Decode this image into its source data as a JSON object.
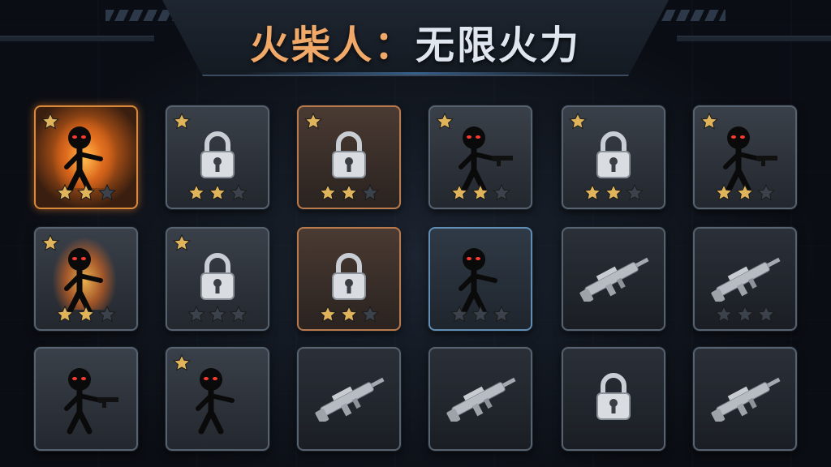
{
  "title": {
    "part1": "火柴人：",
    "part2": "无限火力"
  },
  "colors": {
    "star_gold": "#e0b45a",
    "star_empty": "#3c424b",
    "accent_orange": "#d9893a",
    "accent_blue": "#5f8db5"
  },
  "cards": [
    {
      "name": "card-1",
      "style": "active",
      "content": "stickman",
      "corner_star": true,
      "stars_filled": 2,
      "stars_total": 3,
      "fire": true
    },
    {
      "name": "card-2",
      "style": "normal",
      "content": "lock",
      "corner_star": true,
      "stars_filled": 2,
      "stars_total": 3
    },
    {
      "name": "card-3",
      "style": "orange",
      "content": "lock",
      "corner_star": true,
      "stars_filled": 2,
      "stars_total": 3
    },
    {
      "name": "card-4",
      "style": "normal",
      "content": "stickman-gun",
      "corner_star": true,
      "stars_filled": 2,
      "stars_total": 3
    },
    {
      "name": "card-5",
      "style": "normal",
      "content": "lock",
      "corner_star": true,
      "stars_filled": 2,
      "stars_total": 3
    },
    {
      "name": "card-6",
      "style": "normal",
      "content": "stickman-gun",
      "corner_star": true,
      "stars_filled": 2,
      "stars_total": 3
    },
    {
      "name": "card-7",
      "style": "normal",
      "content": "stickman",
      "corner_star": true,
      "stars_filled": 2,
      "stars_total": 3,
      "fire": true
    },
    {
      "name": "card-8",
      "style": "normal",
      "content": "lock",
      "corner_star": true,
      "stars_filled": 0,
      "stars_total": 3
    },
    {
      "name": "card-9",
      "style": "orange",
      "content": "lock",
      "corner_star": false,
      "stars_filled": 2,
      "stars_total": 3
    },
    {
      "name": "card-10",
      "style": "blue",
      "content": "stickman",
      "corner_star": false,
      "stars_filled": 0,
      "stars_total": 3
    },
    {
      "name": "card-11",
      "style": "dark",
      "content": "rifle",
      "corner_star": false,
      "stars_filled": 0,
      "stars_total": 0
    },
    {
      "name": "card-12",
      "style": "dark",
      "content": "rifle",
      "corner_star": false,
      "stars_filled": 0,
      "stars_total": 3
    },
    {
      "name": "card-13",
      "style": "normal",
      "content": "stickman-gun",
      "corner_star": false,
      "stars_filled": 0,
      "stars_total": 0
    },
    {
      "name": "card-14",
      "style": "normal",
      "content": "stickman",
      "corner_star": true,
      "stars_filled": 0,
      "stars_total": 0
    },
    {
      "name": "card-15",
      "style": "dark",
      "content": "rifle",
      "corner_star": false,
      "stars_filled": 0,
      "stars_total": 0
    },
    {
      "name": "card-16",
      "style": "dark",
      "content": "rifle",
      "corner_star": false,
      "stars_filled": 0,
      "stars_total": 0
    },
    {
      "name": "card-17",
      "style": "dark",
      "content": "lock",
      "corner_star": false,
      "stars_filled": 0,
      "stars_total": 0
    },
    {
      "name": "card-18",
      "style": "dark",
      "content": "rifle",
      "corner_star": false,
      "stars_filled": 0,
      "stars_total": 0
    }
  ]
}
